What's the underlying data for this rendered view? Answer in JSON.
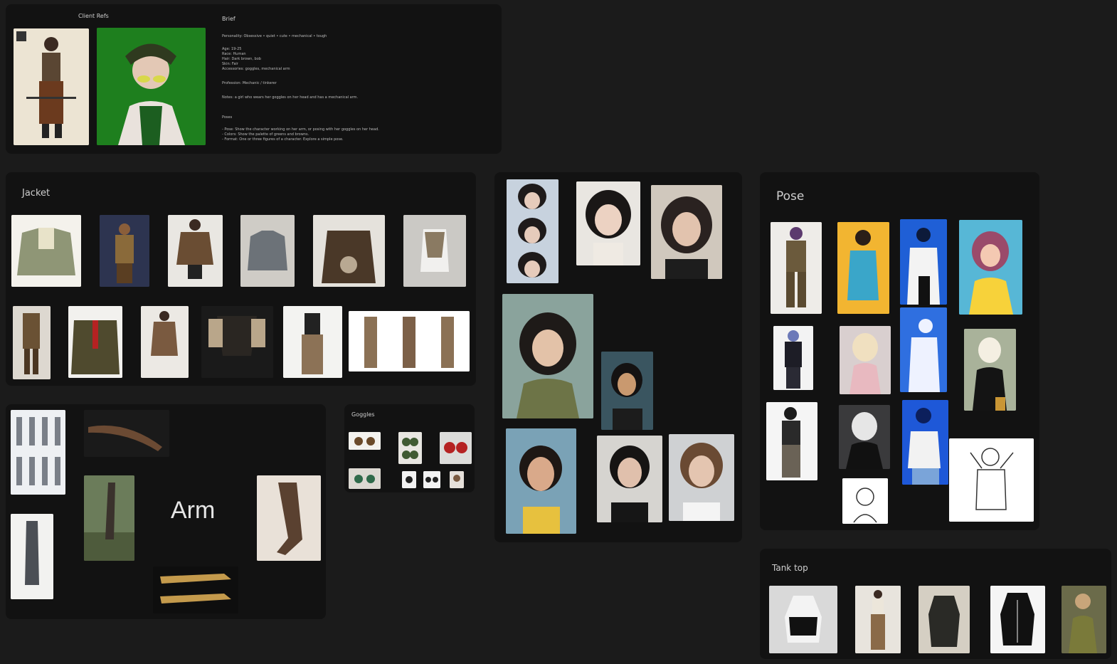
{
  "boards": {
    "client_refs": {
      "title": "Client Refs"
    },
    "brief": {
      "title": "Brief",
      "lines": [
        "Personality: Obsessive • quiet • cute • mechanical • tough",
        "Age: 19-25",
        "Race: Human",
        "Hair: Dark brown, bob",
        "Skin: Fair",
        "Accessories: goggles, mechanical arm",
        "Profession: Mechanic / tinkerer",
        "Notes: a girl who wears her goggles on her head and has a mechanical arm.",
        "Poses",
        "- Pose: Show the character working on her arm, or posing with her goggles on her head.",
        "- Colors: Show the palette of greens and browns.",
        "- Format: One or three figures of a character. Explore a simple pose."
      ]
    },
    "jacket": {
      "title": "Jacket"
    },
    "hair": {
      "title": ""
    },
    "pose": {
      "title": "Pose"
    },
    "arm": {
      "title": "Arm"
    },
    "goggles": {
      "title": "Goggles"
    },
    "tank_top": {
      "title": "Tank top"
    }
  },
  "colors": {
    "background": "#1b1b1b",
    "board": "#121212",
    "green_screen": "#1e7f1e",
    "yellow": "#f2b531",
    "blue": "#1f5fd6"
  }
}
